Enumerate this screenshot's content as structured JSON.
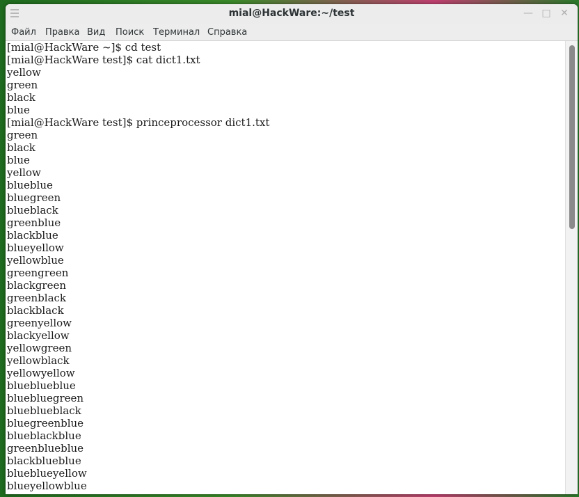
{
  "window": {
    "title": "mial@HackWare:~/test",
    "minimize_glyph": "—",
    "maximize_glyph": "□",
    "close_glyph": "✕"
  },
  "menu": [
    "Файл",
    "Правка",
    "Вид",
    "Поиск",
    "Терминал",
    "Справка"
  ],
  "terminal": {
    "lines": [
      "[mial@HackWare ~]$ cd test",
      "[mial@HackWare test]$ cat dict1.txt",
      "yellow",
      "green",
      "black",
      "blue",
      "[mial@HackWare test]$ princeprocessor dict1.txt",
      "green",
      "black",
      "blue",
      "yellow",
      "blueblue",
      "bluegreen",
      "blueblack",
      "greenblue",
      "blackblue",
      "blueyellow",
      "yellowblue",
      "greengreen",
      "blackgreen",
      "greenblack",
      "blackblack",
      "greenyellow",
      "blackyellow",
      "yellowgreen",
      "yellowblack",
      "yellowyellow",
      "blueblueblue",
      "bluebluegreen",
      "bluebluebla ck",
      "bluegreenblue",
      "blueblackblue",
      "greenblueblue",
      "blackblueblue",
      "blueblueyellow",
      "blueyellowblue"
    ]
  }
}
